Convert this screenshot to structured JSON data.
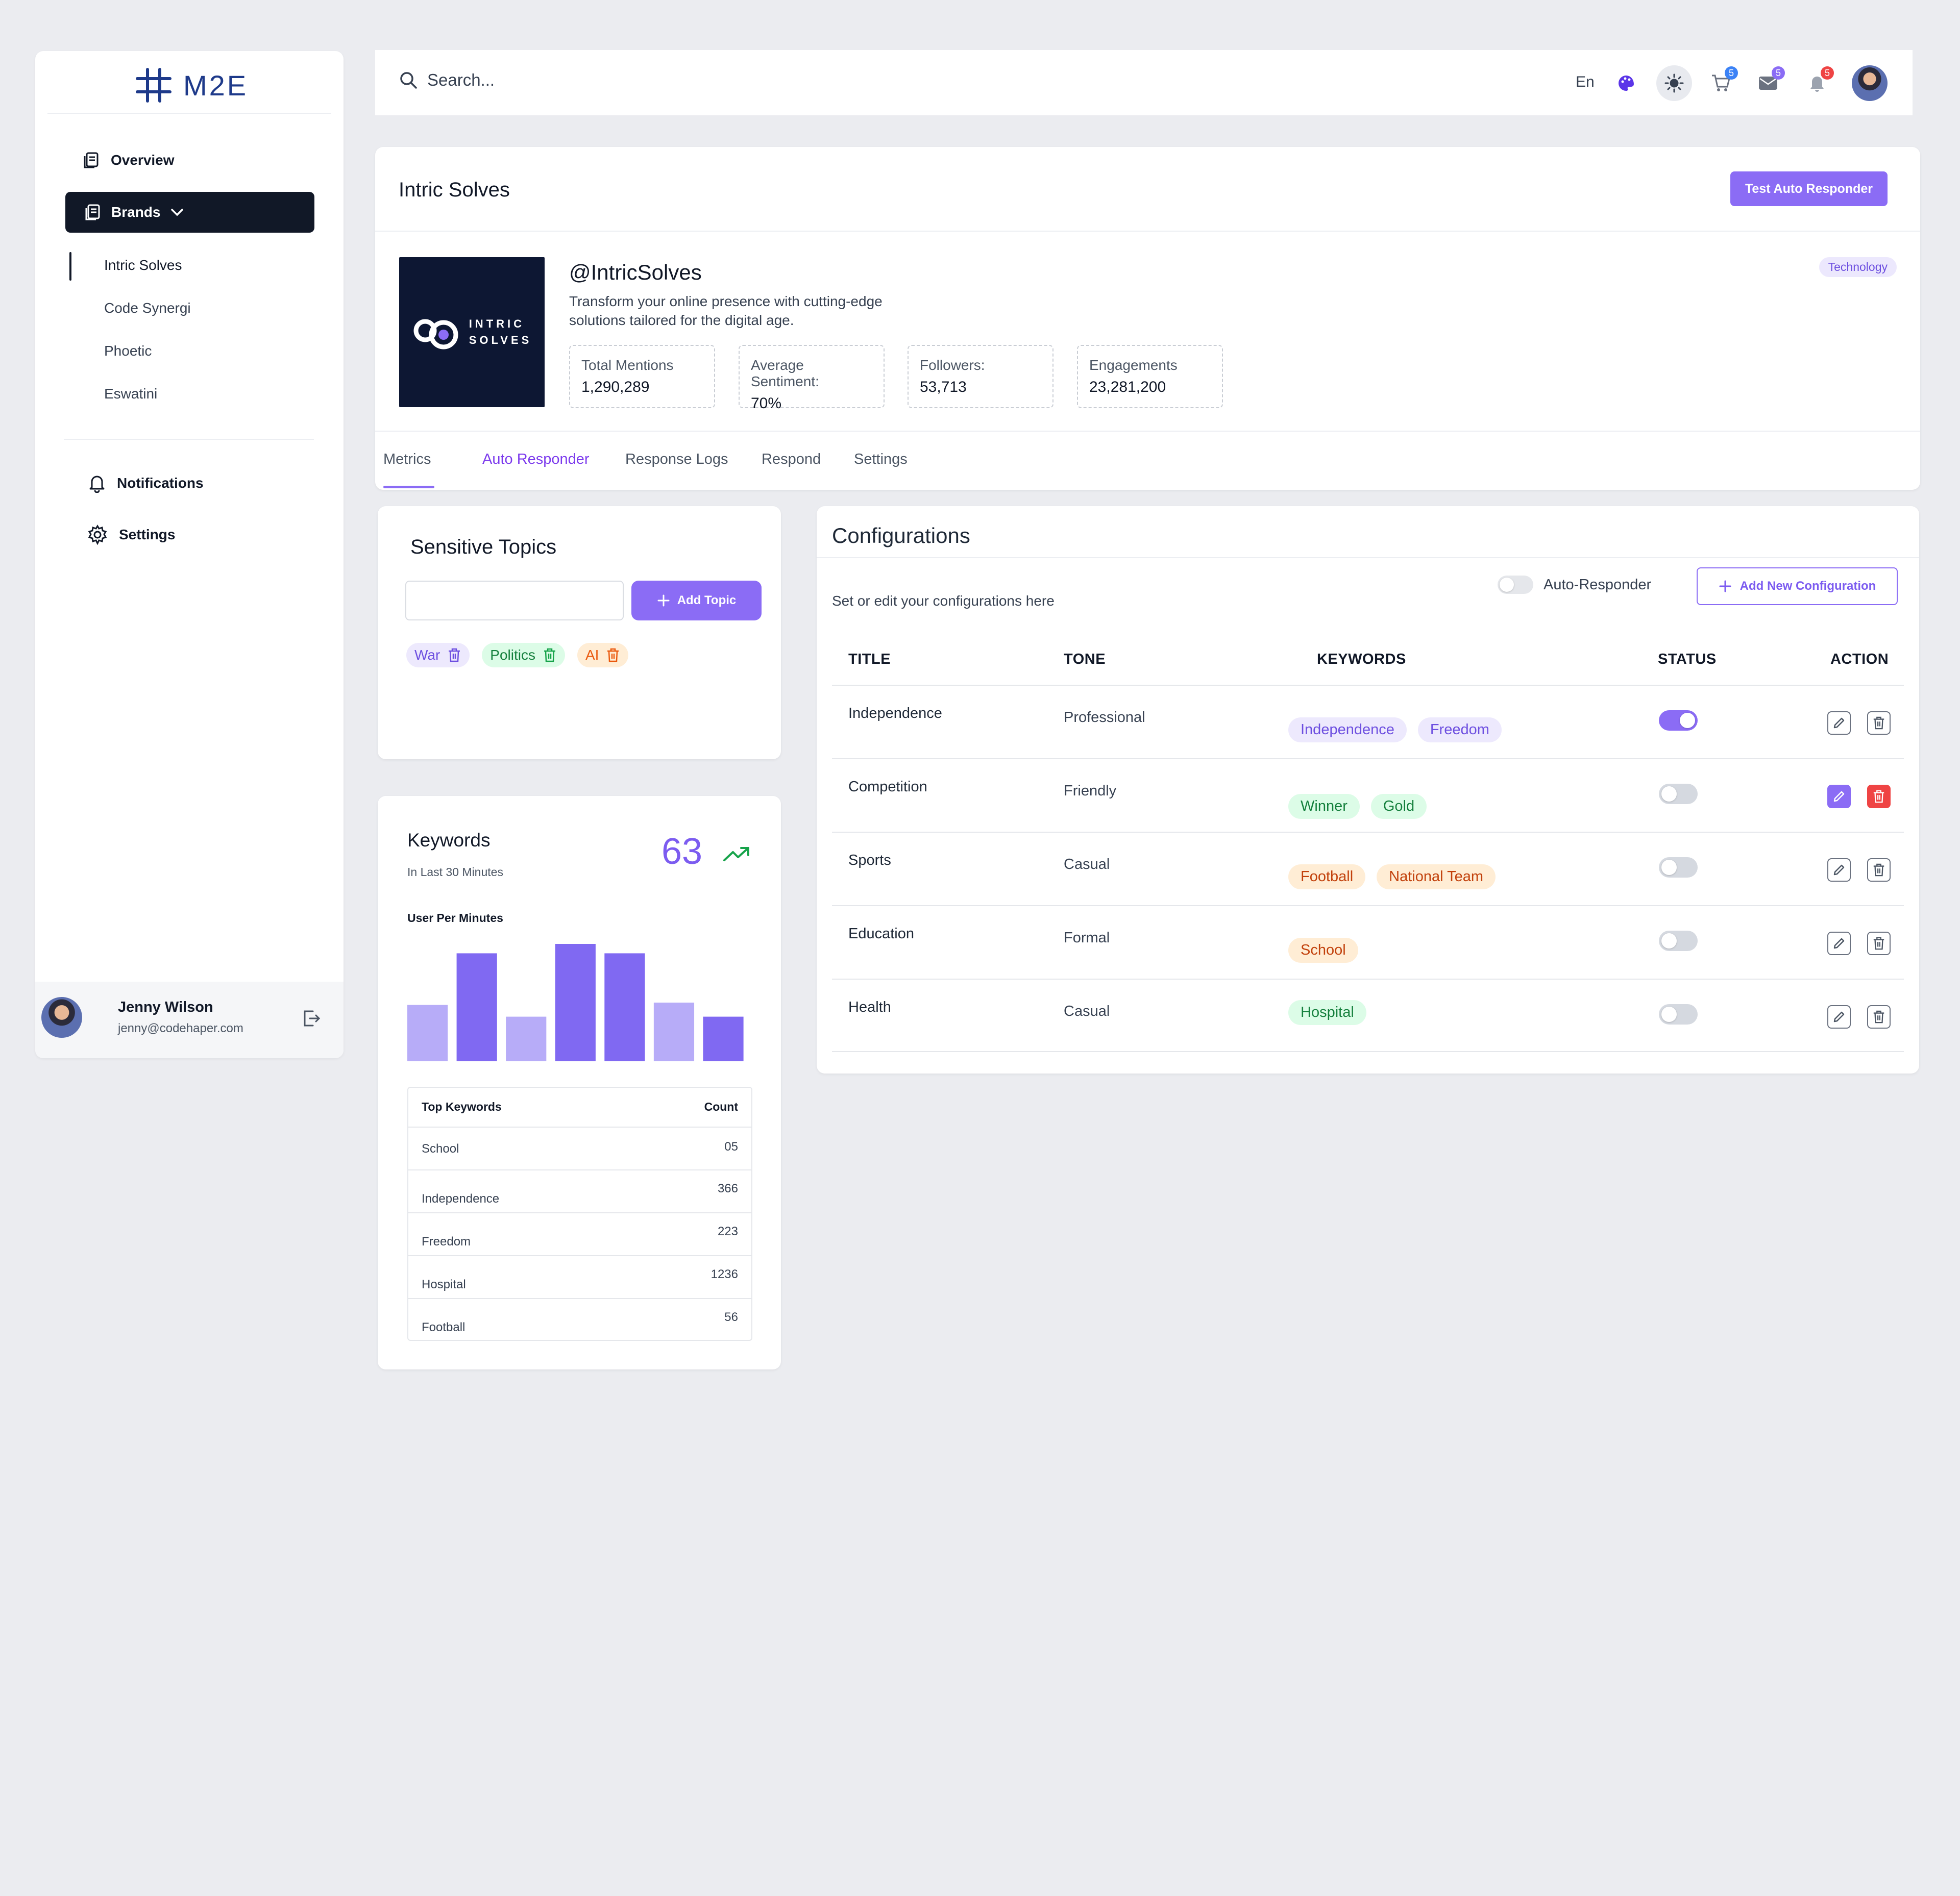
{
  "app": {
    "logo_text": "M2E"
  },
  "sidebar": {
    "overview": "Overview",
    "brands": "Brands",
    "brand_items": [
      "Intric Solves",
      "Code Synergi",
      "Phoetic",
      "Eswatini"
    ],
    "notifications": "Notifications",
    "settings": "Settings",
    "user": {
      "name": "Jenny Wilson",
      "email": "jenny@codehaper.com"
    }
  },
  "header": {
    "search_placeholder": "Search...",
    "language": "En",
    "cart_badge": "5",
    "mail_badge": "5",
    "bell_badge": "5"
  },
  "brand": {
    "title": "Intric Solves",
    "test_button": "Test Auto Responder",
    "logo_line1": "INTRIC",
    "logo_line2": "SOLVES",
    "handle": "@IntricSolves",
    "description_line1": "Transform your online presence with cutting-edge",
    "description_line2": "solutions tailored for the digital age.",
    "category": "Technology",
    "stats": [
      {
        "label": "Total Mentions",
        "value": "1,290,289"
      },
      {
        "label": "Average Sentiment:",
        "value": "70%"
      },
      {
        "label": "Followers:",
        "value": "53,713"
      },
      {
        "label": "Engagements",
        "value": "23,281,200"
      }
    ],
    "tabs": [
      "Metrics",
      "Auto Responder",
      "Response Logs",
      "Respond",
      "Settings"
    ]
  },
  "topics": {
    "title": "Sensitive Topics",
    "input_value": "",
    "add_button": "Add Topic",
    "chips": [
      "War",
      "Politics",
      "AI"
    ]
  },
  "keywords": {
    "title": "Keywords",
    "subtitle": "In Last 30 Minutes",
    "count": "63",
    "chart_label": "User Per Minutes",
    "table_header_name": "Top Keywords",
    "table_header_count": "Count",
    "rows": [
      {
        "name": "School",
        "count": "05"
      },
      {
        "name": "Independence",
        "count": "366"
      },
      {
        "name": "Freedom",
        "count": "223"
      },
      {
        "name": "Hospital",
        "count": "1236"
      },
      {
        "name": "Football",
        "count": "56"
      }
    ]
  },
  "chart_data": {
    "type": "bar",
    "values": [
      48,
      92,
      38,
      100,
      92,
      50,
      38
    ],
    "ylim": [
      0,
      100
    ],
    "colors": [
      "#b7acf8",
      "#8069f2",
      "#b7acf8",
      "#8069f2",
      "#8069f2",
      "#b7acf8",
      "#8069f2"
    ],
    "grid": false
  },
  "config": {
    "title": "Configurations",
    "subtitle": "Set or edit your configurations here",
    "auto_responder_label": "Auto-Responder",
    "add_button": "Add New Configuration",
    "headers": {
      "title": "TITLE",
      "tone": "TONE",
      "keywords": "KEYWORDS",
      "status": "STATUS",
      "action": "ACTION"
    },
    "rows": [
      {
        "title": "Independence",
        "tone": "Professional",
        "keywords": [
          "Independence",
          "Freedom"
        ],
        "kw_style": "purple",
        "status": true
      },
      {
        "title": "Competition",
        "tone": "Friendly",
        "keywords": [
          "Winner",
          "Gold"
        ],
        "kw_style": "green",
        "status": false
      },
      {
        "title": "Sports",
        "tone": "Casual",
        "keywords": [
          "Football",
          "National Team"
        ],
        "kw_style": "orange",
        "status": false
      },
      {
        "title": "Education",
        "tone": "Formal",
        "keywords": [
          "School"
        ],
        "kw_style": "orange",
        "status": false
      },
      {
        "title": "Health",
        "tone": "Casual",
        "keywords": [
          "Hospital"
        ],
        "kw_style": "green",
        "status": false
      }
    ]
  },
  "colors": {
    "accent": "#8b6cf5",
    "dark": "#111827",
    "danger": "#ef4444",
    "success": "#16a34a"
  }
}
